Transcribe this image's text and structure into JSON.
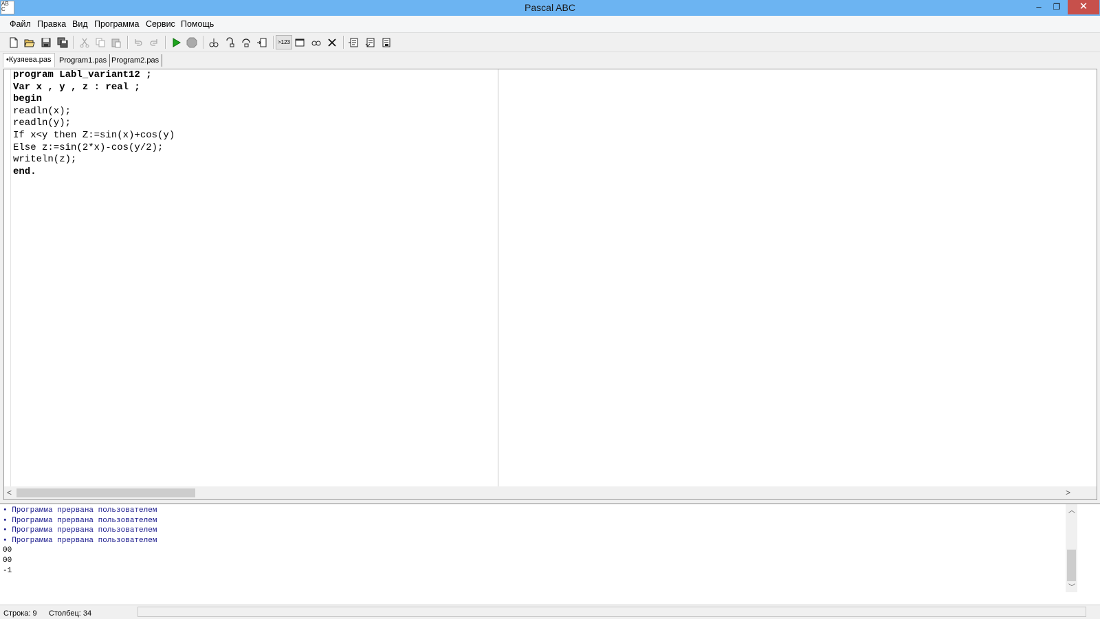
{
  "window": {
    "title": "Pascal ABC",
    "icon_text": "AB C",
    "controls": {
      "minimize": "–",
      "maximize": "❐",
      "close": "✕"
    }
  },
  "menu": [
    "Файл",
    "Правка",
    "Вид",
    "Программа",
    "Сервис",
    "Помощь"
  ],
  "toolbar": {
    "groups": [
      [
        "new-file-icon",
        "open-folder-icon",
        "save-icon",
        "save-all-icon"
      ],
      [
        "cut-icon",
        "copy-icon",
        "paste-icon"
      ],
      [
        "undo-icon",
        "redo-icon"
      ],
      [
        "run-icon",
        "stop-icon"
      ],
      [
        "step-into-icon",
        "step-over-icon",
        "run-to-cursor-icon",
        "watch-icon"
      ],
      [
        "output-toggle-icon",
        "window-icon",
        "evaluate-icon",
        "clear-icon"
      ],
      [
        "format-icon",
        "compile-icon",
        "build-icon"
      ]
    ],
    "output_toggle_label": ">123"
  },
  "tabs": [
    {
      "label": "•Кузяева.pas",
      "active": true
    },
    {
      "label": "Program1.pas",
      "active": false
    },
    {
      "label": "Program2.pas",
      "active": false
    }
  ],
  "editor": {
    "lines": [
      "program Labl_variant12 ;",
      "Var x , y , z : real ;",
      "begin",
      "readln(x);",
      "readln(y);",
      "If x<y then Z:=sin(x)+cos(y)",
      "Else z:=sin(2*x)-cos(y/2);",
      "writeln(z);",
      "end."
    ]
  },
  "output": {
    "lines": [
      {
        "text": "• Программа прервана пользователем",
        "kind": "message"
      },
      {
        "text": "• Программа прервана пользователем",
        "kind": "message"
      },
      {
        "text": "• Программа прервана пользователем",
        "kind": "message"
      },
      {
        "text": "• Программа прервана пользователем",
        "kind": "message"
      },
      {
        "text": "00",
        "kind": "plain"
      },
      {
        "text": "00",
        "kind": "plain"
      },
      {
        "text": "-1",
        "kind": "plain"
      }
    ]
  },
  "status": {
    "row": "Строка: 9",
    "col": "Столбец: 34"
  },
  "colors": {
    "titlebar": "#6cb4f2",
    "close_button": "#c7504b",
    "message_text": "#1a1a8c"
  }
}
